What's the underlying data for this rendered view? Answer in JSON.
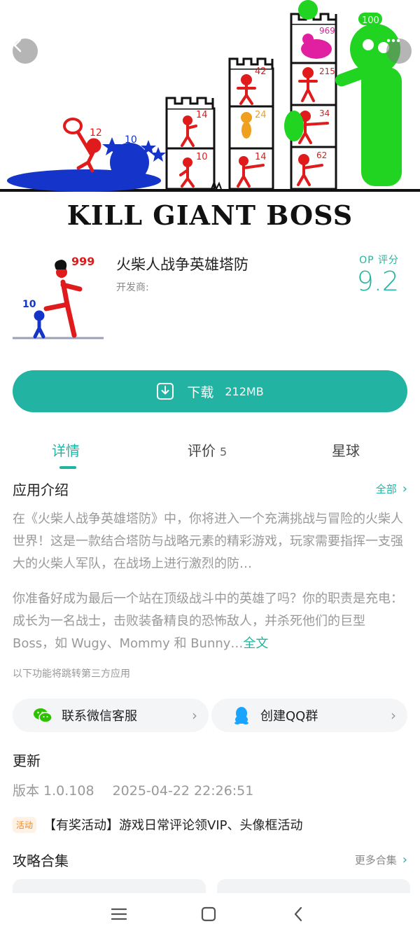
{
  "banner": {
    "title": "KILL GIANT BOSS",
    "numbers": {
      "n12": "12",
      "n10": "10",
      "t1_top": "14",
      "t1_bot": "10",
      "t2_top": "42",
      "t2_mid": "24",
      "t2_bot": "14",
      "t3_top": "969",
      "t3_a": "215",
      "t3_b": "34",
      "t3_c": "62",
      "boss": "100"
    }
  },
  "app": {
    "icon_numbers": {
      "big": "999",
      "small": "10"
    },
    "name": "火柴人战争英雄塔防",
    "developer_label": "开发商:",
    "rating_label": "OP 评分",
    "rating_value": "9.2"
  },
  "download": {
    "label": "下载",
    "size": "212MB"
  },
  "tabs": {
    "details": "详情",
    "reviews": "评价",
    "reviews_count": "5",
    "planet": "星球"
  },
  "intro": {
    "title": "应用介绍",
    "all_link": "全部",
    "para1": "在《火柴人战争英雄塔防》中，你将进入一个充满挑战与冒险的火柴人世界！这是一款结合塔防与战略元素的精彩游戏，玩家需要指挥一支强大的火柴人军队，在战场上进行激烈的防…",
    "para2": "你准备好成为最后一个站在顶级战斗中的英雄了吗？你的职责是充电：成长为一名战士，击败装备精良的恐怖敌人，并杀死他们的巨型 Boss，如 Wugy、Mommy 和 Bunny…",
    "full_text": "全文",
    "third_party_note": "以下功能将跳转第三方应用"
  },
  "contact": {
    "wechat": "联系微信客服",
    "qq": "创建QQ群"
  },
  "update": {
    "title": "更新",
    "version": "版本 1.0.108",
    "date": "2025-04-22 22:26:51"
  },
  "event": {
    "tag": "活动",
    "text": "【有奖活动】游戏日常评论领VIP、头像框活动"
  },
  "guides": {
    "title": "攻略合集",
    "more": "更多合集"
  },
  "colors": {
    "accent": "#22b3a3",
    "stick_red": "#e01b1b",
    "blue_giant": "#1534c9",
    "green_boss": "#22d422"
  }
}
